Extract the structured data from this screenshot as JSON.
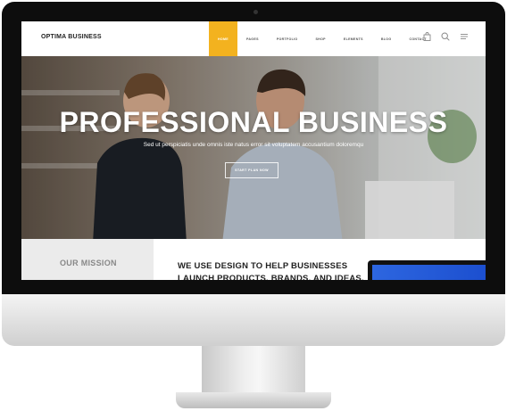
{
  "site": {
    "brand": "OPTIMA BUSINESS",
    "nav": [
      {
        "label": "HOME",
        "active": true
      },
      {
        "label": "PAGES",
        "active": false
      },
      {
        "label": "PORTFOLIO",
        "active": false
      },
      {
        "label": "SHOP",
        "active": false
      },
      {
        "label": "ELEMENTS",
        "active": false
      },
      {
        "label": "BLOG",
        "active": false
      },
      {
        "label": "CONTACT",
        "active": false
      }
    ],
    "nav_icons": [
      "shopping-bag-icon",
      "search-icon",
      "menu-icon"
    ],
    "accent_color": "#f3b21f"
  },
  "hero": {
    "title": "PROFESSIONAL BUSINESS",
    "subtitle": "Sed ut perspiciatis unde omnis iste natus error sit voluptatem accusantium doloremqu",
    "button": "START PLAN NOW"
  },
  "mission": {
    "label": "OUR MISSION"
  },
  "content": {
    "heading": "WE USE DESIGN TO HELP BUSINESSES LAUNCH PRODUCTS, BRANDS, AND IDEAS."
  }
}
